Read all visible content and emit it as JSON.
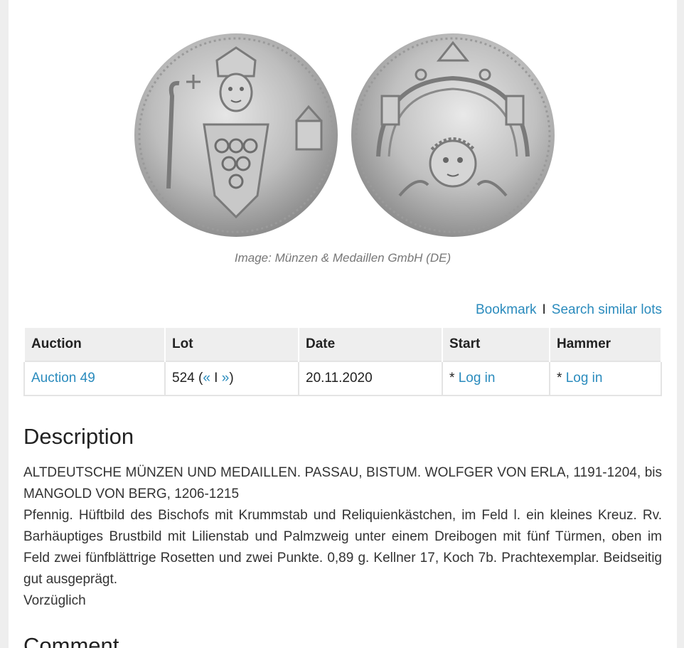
{
  "image_caption": "Image: Münzen & Medaillen GmbH (DE)",
  "actions": {
    "bookmark": "Bookmark",
    "separator": "I",
    "search_similar": "Search similar lots"
  },
  "table": {
    "headers": {
      "auction": "Auction",
      "lot": "Lot",
      "date": "Date",
      "start": "Start",
      "hammer": "Hammer"
    },
    "row": {
      "auction": "Auction 49",
      "lot_number": "524 (",
      "prev": "«",
      "lot_sep": " I ",
      "next": "»",
      "lot_close": ")",
      "date": "20.11.2020",
      "start_prefix": "* ",
      "start_link": "Log in",
      "hammer_prefix": "* ",
      "hammer_link": "Log in"
    }
  },
  "description": {
    "title": "Description",
    "line1": "ALTDEUTSCHE MÜNZEN UND MEDAILLEN. PASSAU, BISTUM. WOLFGER VON ERLA, 1191-1204, bis MANGOLD VON BERG, 1206-1215",
    "line2": "Pfennig. Hüftbild des Bischofs mit Krummstab und Reliquienkästchen, im Feld l. ein kleines Kreuz. Rv. Barhäuptiges Brustbild mit Lilienstab und Palmzweig unter einem Dreibogen mit fünf Türmen, oben im Feld zwei fünfblättrige Rosetten und zwei Punkte. 0,89 g. Kellner 17, Koch 7b. Prachtexemplar. Beidseitig gut ausgeprägt.",
    "line3": "Vorzüglich"
  },
  "next_section_title": "Comment"
}
